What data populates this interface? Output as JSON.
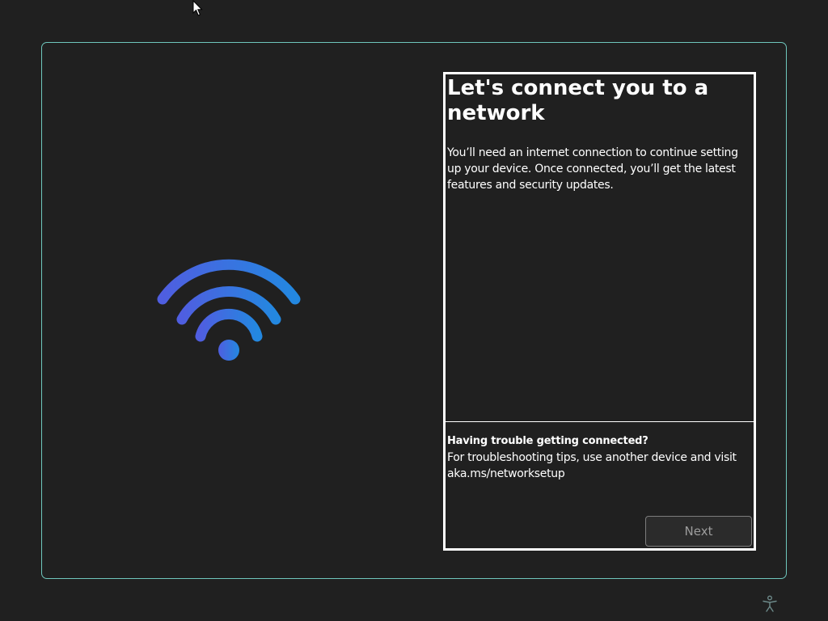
{
  "page": {
    "title": "Let's connect you to a network",
    "description": "You’ll need an internet connection to continue setting up your device. Once connected, you’ll get the latest features and security updates."
  },
  "help": {
    "title": "Having trouble getting connected?",
    "text": "For troubleshooting tips, use another device and visit aka.ms/networksetup"
  },
  "buttons": {
    "next_label": "Next"
  },
  "icons": {
    "illustration": "wifi-icon",
    "accessibility": "accessibility-icon",
    "cursor": "mouse-cursor-icon"
  },
  "colors": {
    "background": "#202020",
    "frame_border": "#6fc7bd",
    "wifi_gradient_start": "#4f5ee0",
    "wifi_gradient_end": "#2388e0"
  }
}
